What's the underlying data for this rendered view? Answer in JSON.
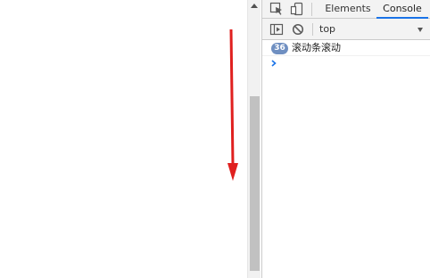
{
  "devtools": {
    "tabs": [
      {
        "label": "Elements",
        "active": false
      },
      {
        "label": "Console",
        "active": true
      }
    ],
    "toolbar": {
      "context_value": "top"
    },
    "console": {
      "messages": [
        {
          "count": "36",
          "text": "滚动条滚动"
        }
      ]
    }
  },
  "colors": {
    "arrow": "#e0201f",
    "active_tab_underline": "#1a73e8",
    "badge": "#6f8fc1",
    "prompt": "#1a73e8"
  },
  "icons": {
    "inspect": "inspect-element-icon",
    "device": "device-toolbar-icon",
    "sidebar": "console-sidebar-icon",
    "clear": "clear-console-icon",
    "prompt": "console-prompt-chevron-icon",
    "scroll_up": "scroll-up-arrow-icon"
  }
}
